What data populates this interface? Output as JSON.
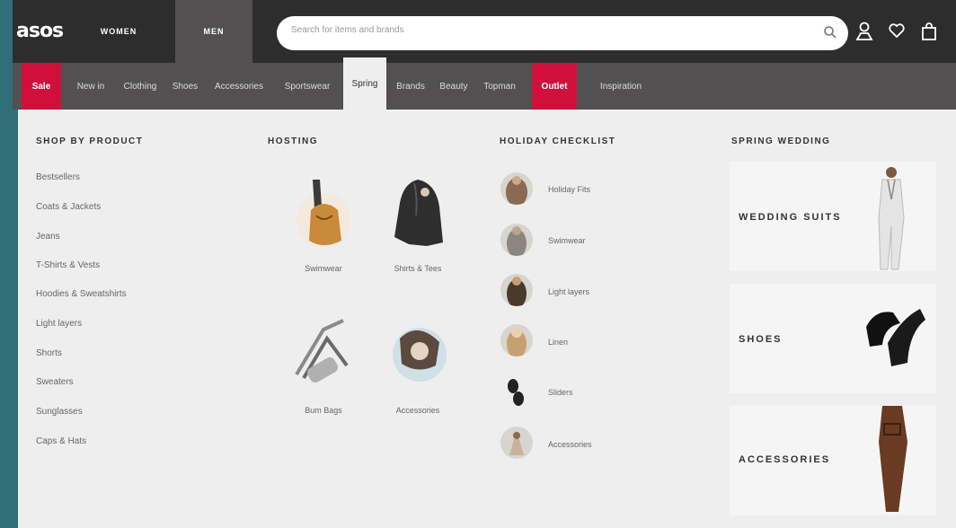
{
  "header": {
    "logo": "asos",
    "tabs": [
      "WOMEN",
      "MEN"
    ],
    "search_placeholder": "Search for items and brands"
  },
  "categories": [
    {
      "label": "Sale",
      "style": "pink"
    },
    {
      "label": "New in",
      "style": "normal"
    },
    {
      "label": "Clothing",
      "style": "normal"
    },
    {
      "label": "Shoes",
      "style": "normal"
    },
    {
      "label": "Accessories",
      "style": "normal"
    },
    {
      "label": "Sportswear",
      "style": "normal"
    },
    {
      "label": "Spring",
      "style": "active"
    },
    {
      "label": "Brands",
      "style": "normal"
    },
    {
      "label": "Beauty",
      "style": "normal"
    },
    {
      "label": "Topman",
      "style": "normal"
    },
    {
      "label": "Outlet",
      "style": "pink"
    },
    {
      "label": "Inspiration",
      "style": "normal"
    }
  ],
  "shop_by_product": {
    "title": "SHOP BY PRODUCT",
    "items": [
      "Bestsellers",
      "Coats & Jackets",
      "Jeans",
      "T-Shirts & Vests",
      "Hoodies & Sweatshirts",
      "Light layers",
      "Shorts",
      "Sweaters",
      "Sunglasses",
      "Caps & Hats"
    ]
  },
  "hosting": {
    "title": "HOSTING",
    "tiles": [
      "Swimwear",
      "Shirts & Tees",
      "Bum Bags",
      "Accessories"
    ]
  },
  "holiday_checklist": {
    "title": "HOLIDAY CHECKLIST",
    "items": [
      "Holiday Fits",
      "Swimwear",
      "Light layers",
      "Linen",
      "Sliders",
      "Accessories"
    ]
  },
  "spring_wedding": {
    "title": "SPRING WEDDING",
    "cards": [
      "WEDDING SUITS",
      "SHOES",
      "ACCESSORIES"
    ]
  },
  "colors": {
    "header": "#2d2d2d",
    "catbar": "#525050",
    "sale_pink": "#d0103a",
    "panel": "#eeeeee",
    "backdrop": "#2f6f78"
  }
}
